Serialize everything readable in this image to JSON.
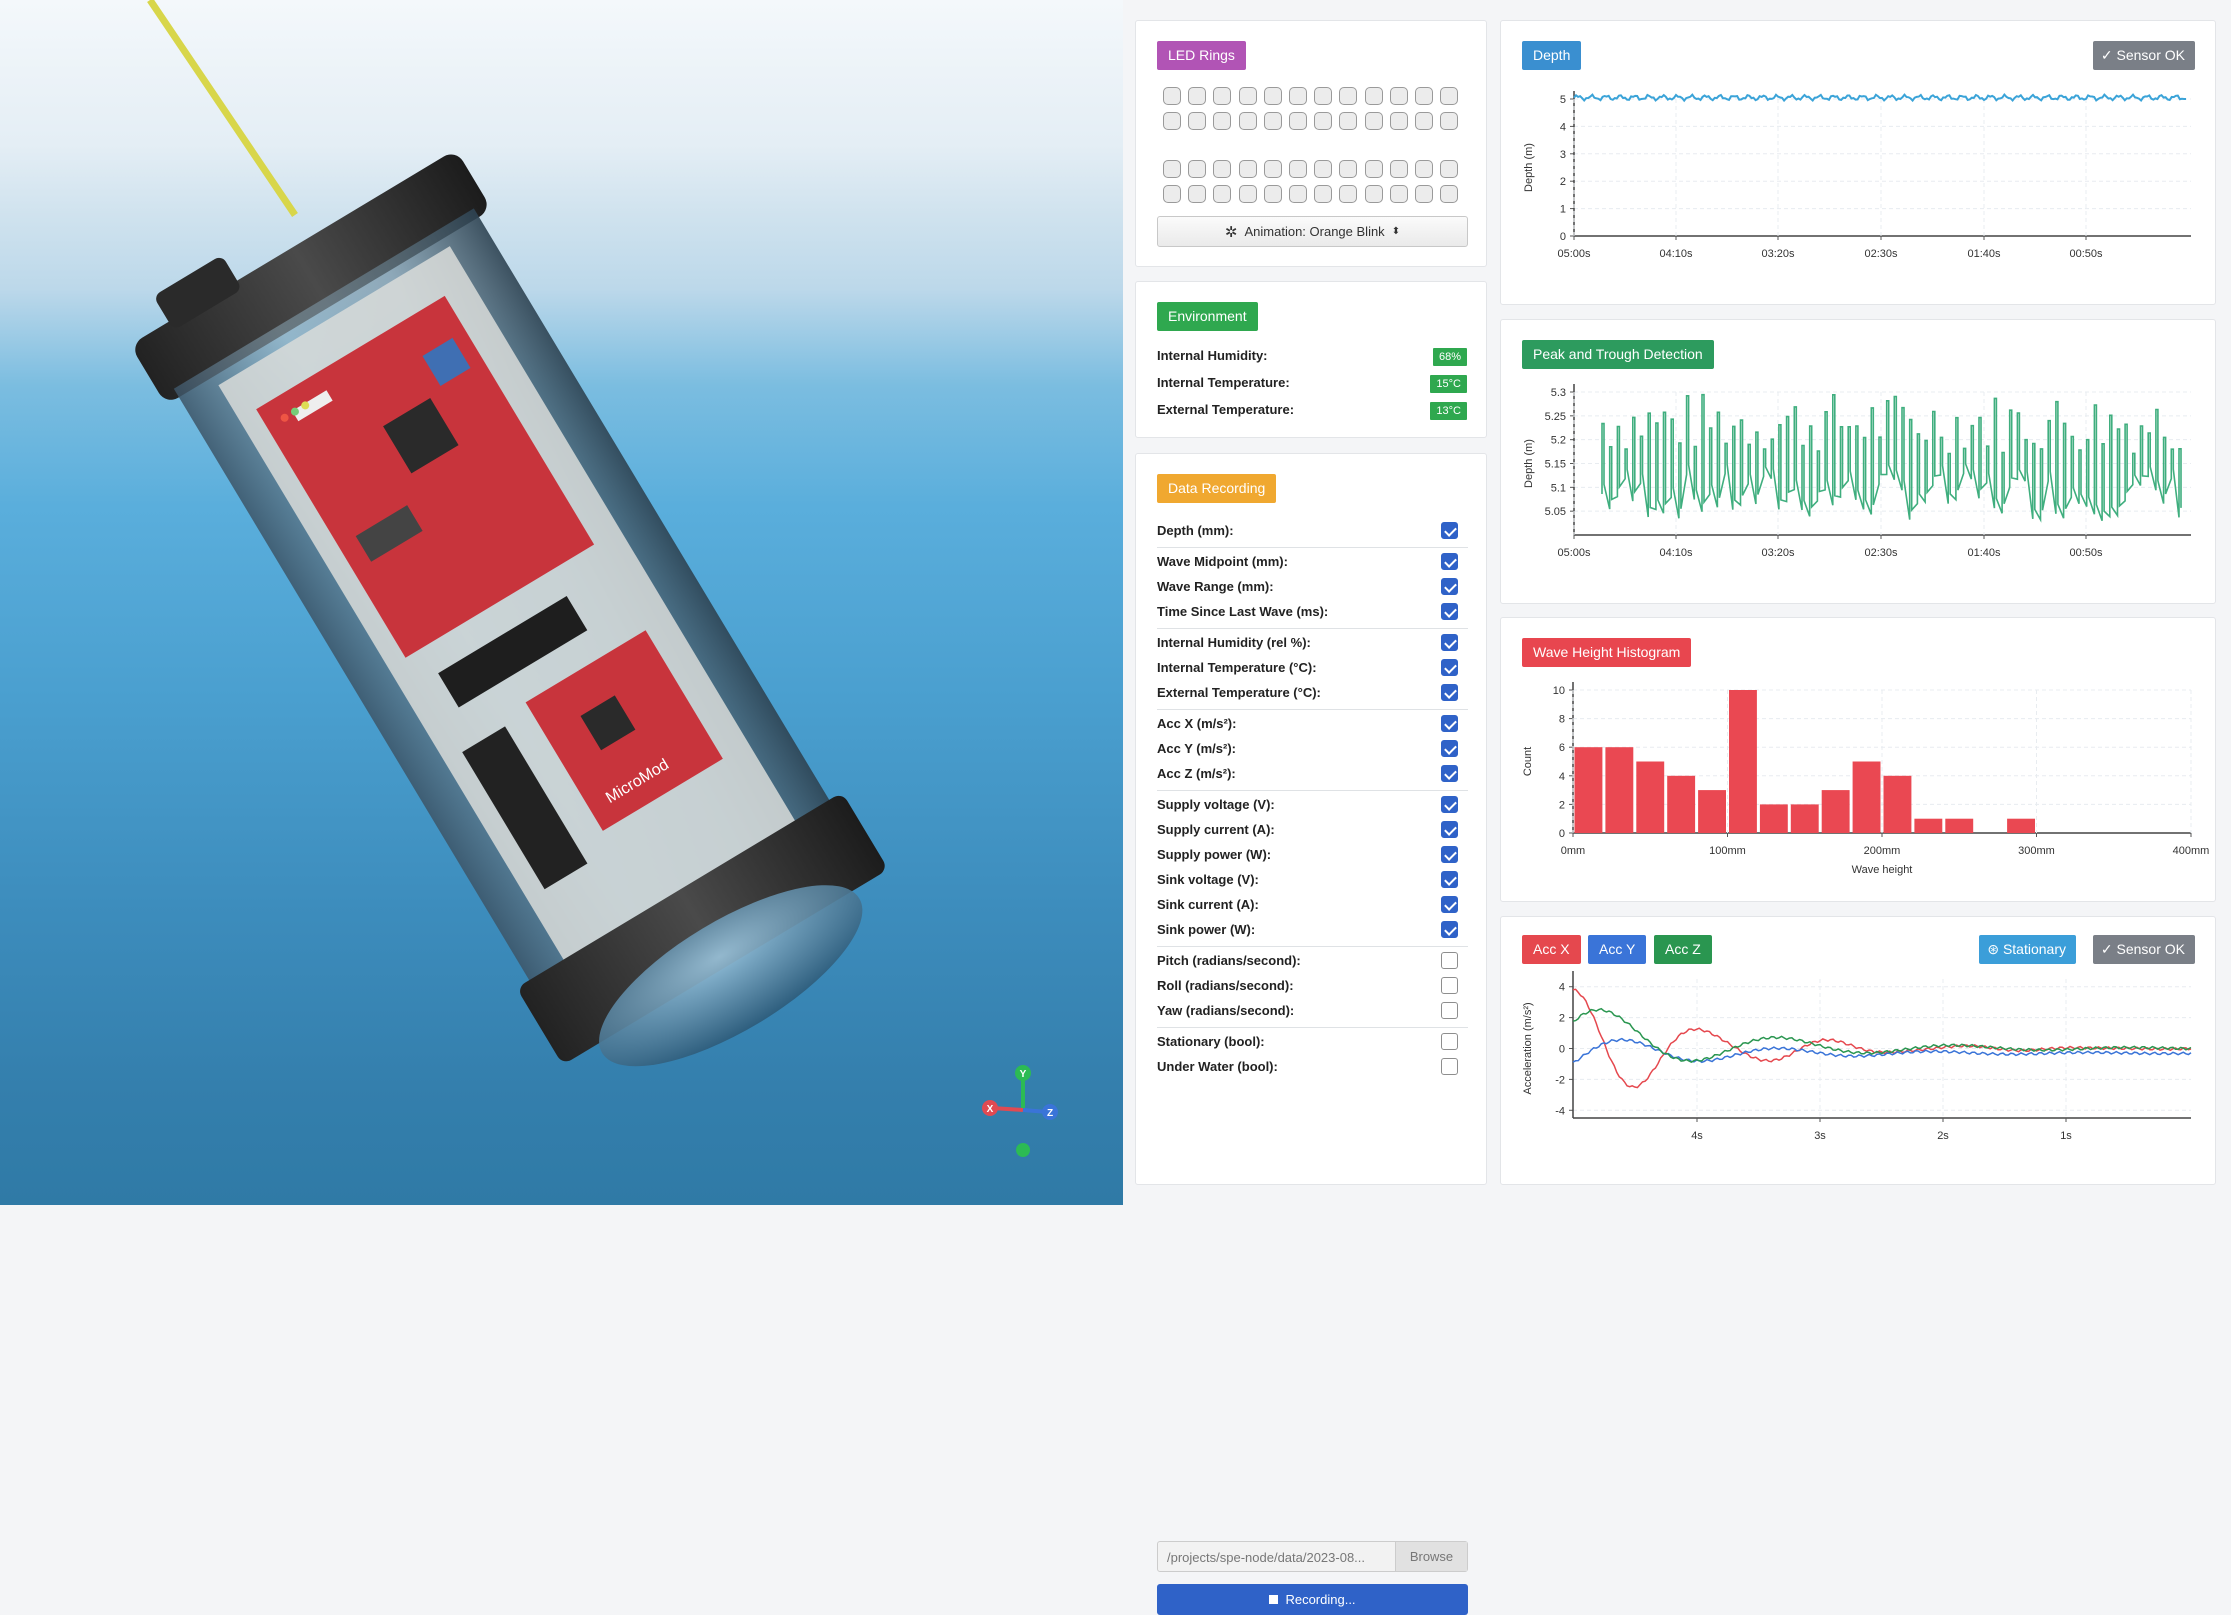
{
  "led_panel": {
    "title": "LED Rings",
    "title_color": "#b154b5",
    "ring_rows": 4,
    "leds_per_row": 12,
    "animation_label": "Animation: Orange Blink"
  },
  "environment": {
    "title": "Environment",
    "title_color": "#2fa84f",
    "rows": [
      {
        "label": "Internal Humidity:",
        "value": "68%"
      },
      {
        "label": "Internal Temperature:",
        "value": "15°C"
      },
      {
        "label": "External Temperature:",
        "value": "13°C"
      }
    ]
  },
  "recording": {
    "title": "Data Recording",
    "title_color": "#f0a830",
    "items": [
      {
        "label": "Depth (mm):",
        "checked": true
      },
      {
        "label": "Wave Midpoint (mm):",
        "checked": true
      },
      {
        "label": "Wave Range (mm):",
        "checked": true
      },
      {
        "label": "Time Since Last Wave (ms):",
        "checked": true
      },
      {
        "label": "Internal Humidity (rel %):",
        "checked": true
      },
      {
        "label": "Internal Temperature (°C):",
        "checked": true
      },
      {
        "label": "External Temperature (°C):",
        "checked": true
      },
      {
        "label": "Acc X (m/s²):",
        "checked": true
      },
      {
        "label": "Acc Y (m/s²):",
        "checked": true
      },
      {
        "label": "Acc Z (m/s²):",
        "checked": true
      },
      {
        "label": "Supply voltage (V):",
        "checked": true
      },
      {
        "label": "Supply current (A):",
        "checked": true
      },
      {
        "label": "Supply power (W):",
        "checked": true
      },
      {
        "label": "Sink voltage (V):",
        "checked": true
      },
      {
        "label": "Sink current (A):",
        "checked": true
      },
      {
        "label": "Sink power (W):",
        "checked": true
      },
      {
        "label": "Pitch (radians/second):",
        "checked": false
      },
      {
        "label": "Roll (radians/second):",
        "checked": false
      },
      {
        "label": "Yaw (radians/second):",
        "checked": false
      },
      {
        "label": "Stationary (bool):",
        "checked": false
      },
      {
        "label": "Under Water (bool):",
        "checked": false
      }
    ],
    "path": "/projects/spe-node/data/2023-08...",
    "browse_label": "Browse",
    "record_label": "Recording..."
  },
  "viewport": {
    "axes_labels": {
      "x": "X",
      "y": "Y",
      "z": "Z"
    },
    "pcb_text": "MicroMod"
  },
  "chart_data": [
    {
      "type": "line",
      "title": "Depth",
      "title_color": "#3a8fd0",
      "sensor_label": "Sensor OK",
      "xlabel": "",
      "ylabel": "Depth (m)",
      "x_ticks": [
        "05:00s",
        "04:10s",
        "03:20s",
        "02:30s",
        "01:40s",
        "00:50s"
      ],
      "ylim": [
        0,
        5
      ],
      "y_ticks": [
        "0",
        "1",
        "2",
        "3",
        "4",
        "5"
      ],
      "series": [
        {
          "color": "#3aa3d8",
          "approx_value": 5.05
        }
      ]
    },
    {
      "type": "line",
      "title": "Peak and Trough Detection",
      "title_color": "#2d9b5e",
      "xlabel": "",
      "ylabel": "Depth (m)",
      "x_ticks": [
        "05:00s",
        "04:10s",
        "03:20s",
        "02:30s",
        "01:40s",
        "00:50s"
      ],
      "ylim": [
        5.0,
        5.3
      ],
      "y_ticks": [
        "5.05",
        "5.1",
        "5.15",
        "5.2",
        "5.25",
        "5.3"
      ],
      "series": [
        {
          "color": "#3fae7e"
        }
      ]
    },
    {
      "type": "bar",
      "title": "Wave Height Histogram",
      "title_color": "#e8464f",
      "xlabel": "Wave height",
      "ylabel": "Count",
      "x_ticks": [
        "0mm",
        "100mm",
        "200mm",
        "300mm",
        "400mm"
      ],
      "xlim": [
        0,
        400
      ],
      "ylim": [
        0,
        10
      ],
      "y_ticks": [
        "0",
        "2",
        "4",
        "6",
        "8",
        "10"
      ],
      "bin_width": 20,
      "values": [
        6,
        6,
        5,
        4,
        3,
        10,
        2,
        2,
        3,
        5,
        4,
        1,
        1,
        0,
        1,
        0,
        0,
        0,
        0,
        0
      ],
      "bar_color": "#ea4852"
    },
    {
      "type": "line",
      "title": "",
      "legend": [
        {
          "name": "Acc X",
          "color": "#e5484e"
        },
        {
          "name": "Acc Y",
          "color": "#3a74d8"
        },
        {
          "name": "Acc Z",
          "color": "#2a9650"
        }
      ],
      "stationary_label": "Stationary",
      "sensor_label": "Sensor OK",
      "ylabel": "Acceleration (m/s²)",
      "x_ticks": [
        "4s",
        "3s",
        "2s",
        "1s"
      ],
      "ylim": [
        -4.5,
        4.5
      ],
      "y_ticks": [
        "-4",
        "-2",
        "0",
        "2",
        "4"
      ]
    }
  ]
}
